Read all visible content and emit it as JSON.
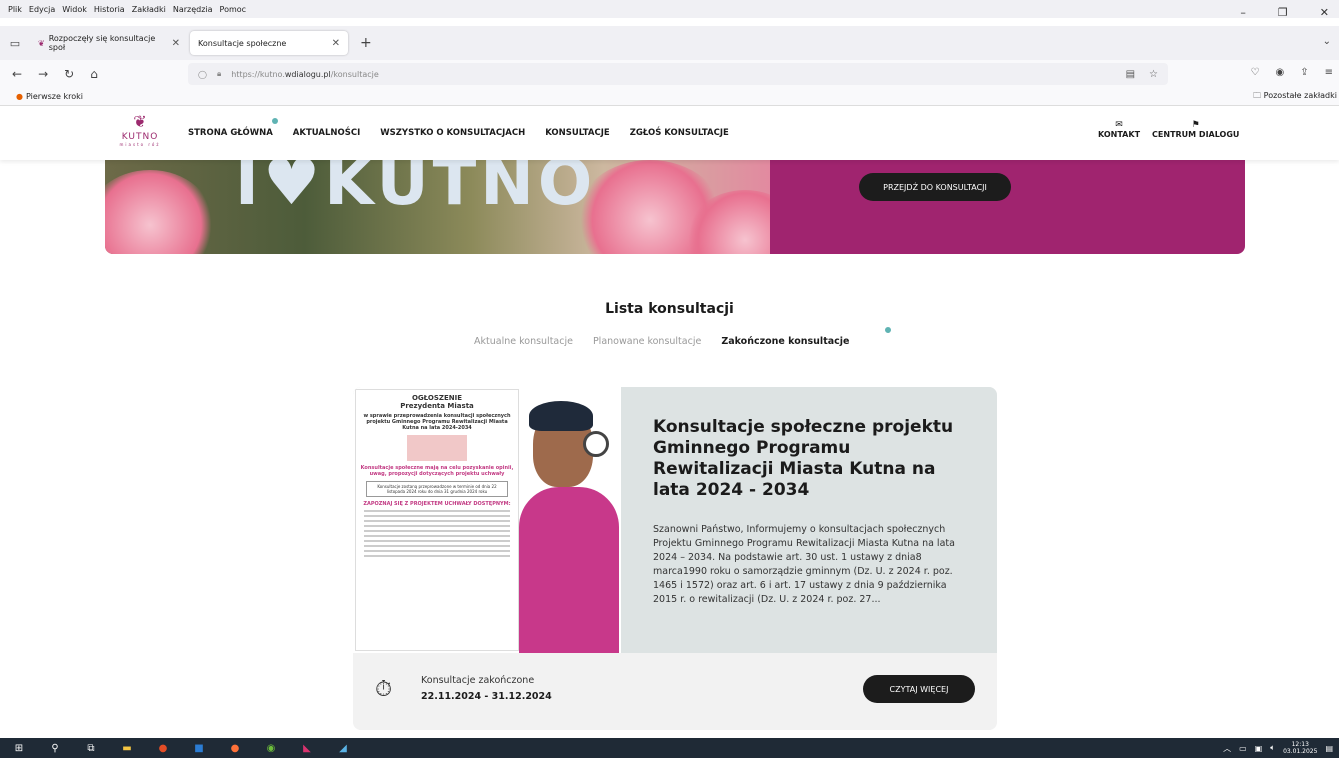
{
  "menubar": {
    "items": [
      "Plik",
      "Edycja",
      "Widok",
      "Historia",
      "Zakładki",
      "Narzędzia",
      "Pomoc"
    ]
  },
  "tabs": [
    {
      "label": "Rozpoczęły się konsultacje społ"
    },
    {
      "label": "Konsultacje społeczne"
    }
  ],
  "address": {
    "prefix": "https://kutno.",
    "domain": "wdialogu.pl",
    "path": "/konsultacje"
  },
  "bookmarks": {
    "first": "Pierwsze kroki",
    "other": "Pozostałe zakładki"
  },
  "site": {
    "logo": {
      "name": "KUTNO",
      "sub": "miasto róż"
    },
    "nav": [
      "STRONA GŁÓWNA",
      "AKTUALNOŚCI",
      "WSZYSTKO O KONSULTACJACH",
      "KONSULTACJE",
      "ZGŁOŚ KONSULTACJE"
    ],
    "nav_right": [
      {
        "icon": "✉",
        "label": "KONTAKT"
      },
      {
        "icon": "⚑",
        "label": "CENTRUM DIALOGU"
      }
    ],
    "hero": {
      "letters": "I♥KUTNO",
      "button": "PRZEJDŹ DO KONSULTACJI"
    },
    "list_title": "Lista konsultacji",
    "filters": {
      "current": "Aktualne konsultacje",
      "planned": "Planowane konsultacje",
      "finished": "Zakończone konsultacje"
    },
    "card": {
      "poster": {
        "title1": "OGŁOSZENIE",
        "title2": "Prezydenta Miasta",
        "sub": "w sprawie przeprowadzenia konsultacji społecznych projektu Gminnego Programu Rewitalizacji Miasta Kutna na lata 2024-2034",
        "pink": "Konsultacje społeczne mają na celu pozyskanie opinii, uwag, propozycji dotyczących projektu uchwały",
        "box": "Konsultacje zostaną przeprowadzone w terminie od dnia 22 listopada 2024 roku do dnia 31 grudnia 2024 roku",
        "cta": "ZAPOZNAJ SIĘ Z PROJEKTEM UCHWAŁY DOSTĘPNYM:"
      },
      "title": "Konsultacje społeczne projektu Gminnego Programu Rewitalizacji Miasta Kutna na lata 2024 - 2034",
      "description": "Szanowni Państwo, Informujemy o konsultacjach społecznych Projektu Gminnego Programu Rewitalizacji Miasta Kutna na lata 2024 – 2034. Na podstawie art. 30 ust. 1 ustawy z dnia8 marca1990 roku o samorządzie gminnym (Dz. U. z 2024 r. poz. 1465 i 1572) oraz art. 6 i art. 17 ustawy z dnia 9 października 2015 r. o rewitalizacji (Dz. U. z 2024 r. poz. 27...",
      "status": "Konsultacje zakończone",
      "dates": "22.11.2024 - 31.12.2024",
      "read_more": "CZYTAJ WIĘCEJ"
    }
  },
  "taskbar": {
    "time": "12:13",
    "date": "03.01.2025"
  },
  "colors": {
    "brand": "#a0246f",
    "accent_dot": "#5fb3b3",
    "button": "#1c1c1c"
  }
}
